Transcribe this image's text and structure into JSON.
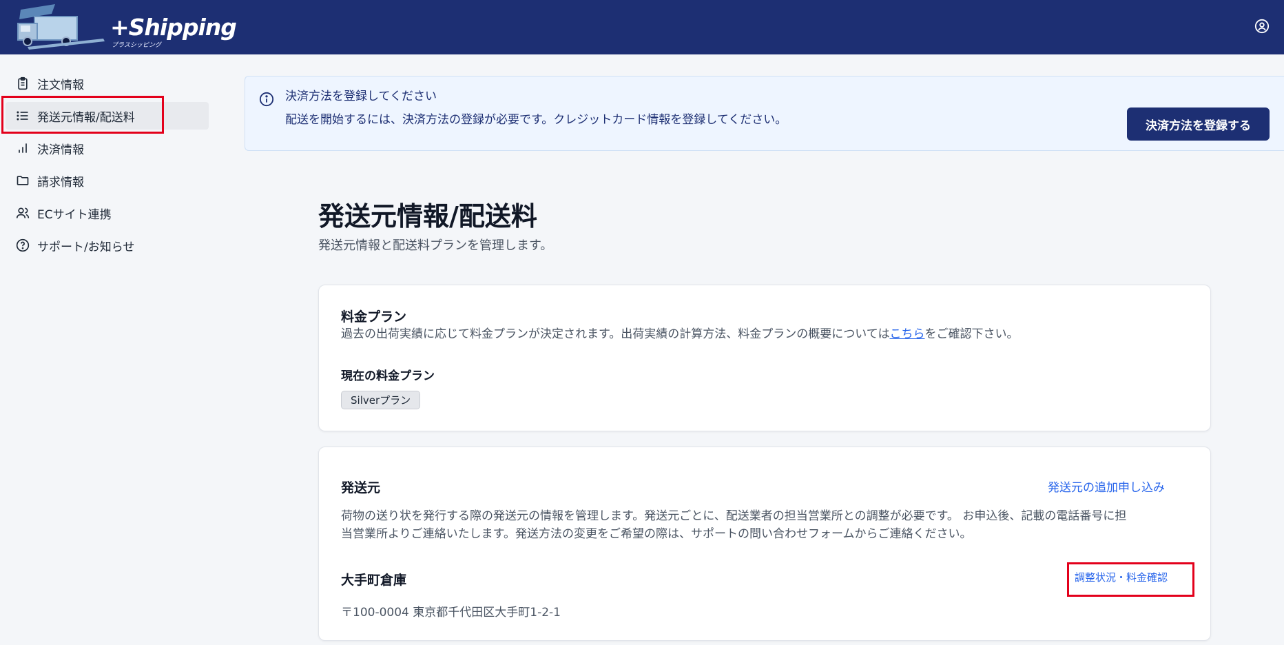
{
  "header": {
    "logo_text": "+Shipping",
    "logo_subtext": "プラスシッピング",
    "account_icon": "account-circle-icon"
  },
  "sidebar": {
    "items": [
      {
        "label": "注文情報",
        "icon": "clipboard-icon"
      },
      {
        "label": "発送元情報/配送料",
        "icon": "list-icon",
        "active": true
      },
      {
        "label": "決済情報",
        "icon": "bar-chart-icon"
      },
      {
        "label": "請求情報",
        "icon": "folder-icon"
      },
      {
        "label": "ECサイト連携",
        "icon": "users-icon"
      },
      {
        "label": "サポート/お知らせ",
        "icon": "help-circle-icon"
      }
    ]
  },
  "alert": {
    "icon": "info-icon",
    "title": "決済方法を登録してください",
    "body": "配送を開始するには、決済方法の登録が必要です。クレジットカード情報を登録してください。",
    "button_label": "決済方法を登録する"
  },
  "page": {
    "title": "発送元情報/配送料",
    "subtitle": "発送元情報と配送料プランを管理します。"
  },
  "plan_card": {
    "title": "料金プラン",
    "desc_before": "過去の出荷実績に応じて料金プランが決定されます。出荷実績の計算方法、料金プランの概要については",
    "desc_link": "こちら",
    "desc_after": "をご確認下さい。",
    "current_label": "現在の料金プラン",
    "current_plan": "Silverプラン"
  },
  "origin_card": {
    "title": "発送元",
    "add_link": "発送元の追加申し込み",
    "desc_line1": "荷物の送り状を発行する際の発送元の情報を管理します。発送元ごとに、配送業者の担当営業所との調整が必要です。 お申込後、記載の電話番号に担",
    "desc_line2": "当営業所よりご連絡いたします。発送方法の変更をご希望の際は、サポートの問い合わせフォームからご連絡ください。",
    "warehouse_name": "大手町倉庫",
    "warehouse_address": "〒100-0004 東京都千代田区大手町1-2-1",
    "status_link": "調整状況・料金確認"
  },
  "colors": {
    "header_bg": "#1d2f73",
    "accent_link": "#2563eb",
    "highlight_border": "#e3001b",
    "alert_bg": "#eef5ff"
  }
}
